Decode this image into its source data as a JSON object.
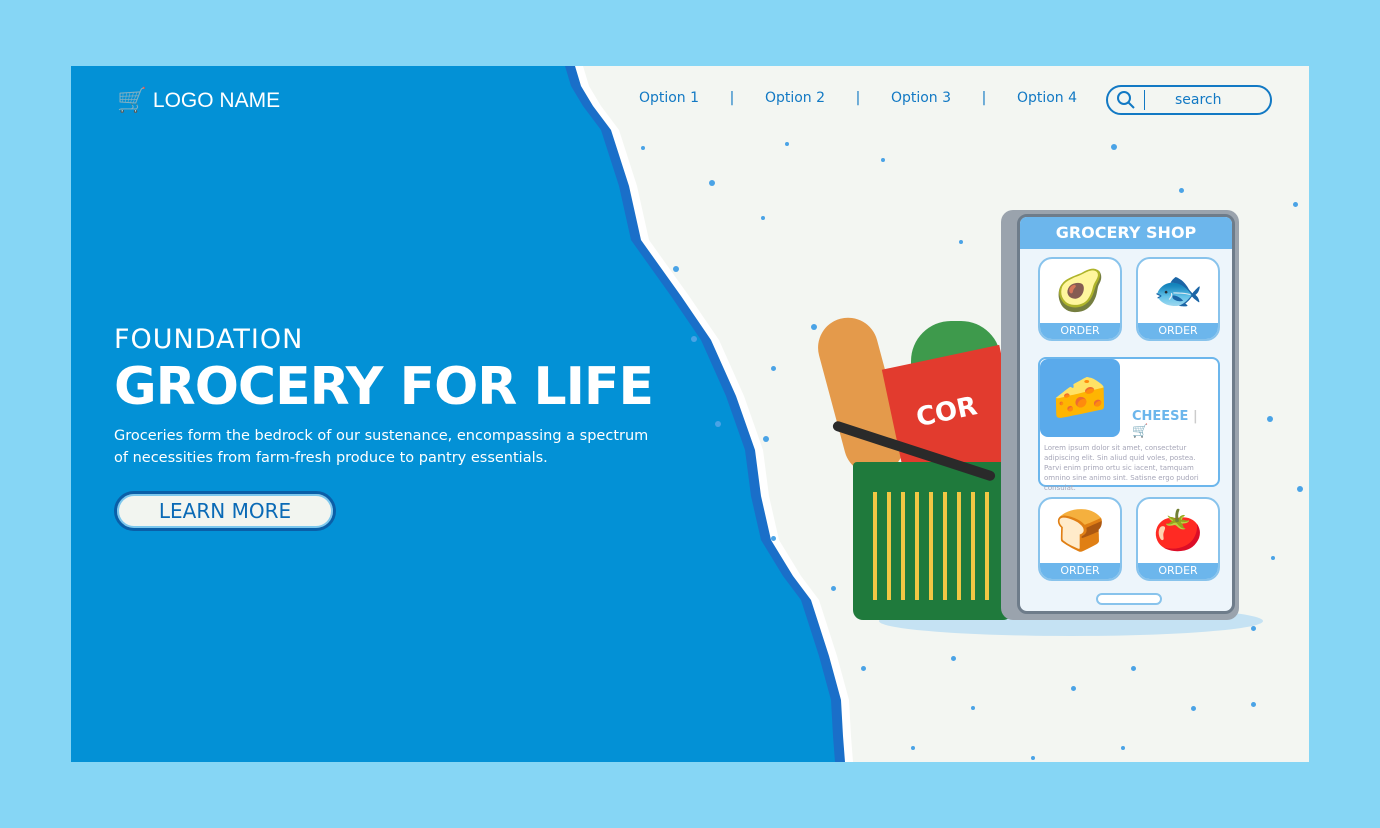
{
  "header": {
    "logo": "LOGO NAME",
    "nav": [
      "Option 1",
      "Option 2",
      "Option 3",
      "Option 4"
    ],
    "search_placeholder": "search"
  },
  "hero": {
    "subtitle": "FOUNDATION",
    "title": "GROCERY FOR LIFE",
    "description": "Groceries form the bedrock of our sustenance, encompassing a spectrum of necessities from farm-fresh produce to pantry essentials.",
    "button": "LEARN MORE"
  },
  "phone": {
    "title": "GROCERY SHOP",
    "order": "ORDER",
    "featured": "CHEESE",
    "lorem": "Lorem ipsum dolor sit amet, consectetur adipiscing elit. Sin aliud quid voles, postea. Parvi enim primo ortu sic iacent, tamquam omnino sine animo sint. Satisne ergo pudori consulat.",
    "box_text": "COR"
  },
  "colors": {
    "brand": "#0391d6",
    "accent": "#1279c4",
    "background": "#86d6f5"
  }
}
